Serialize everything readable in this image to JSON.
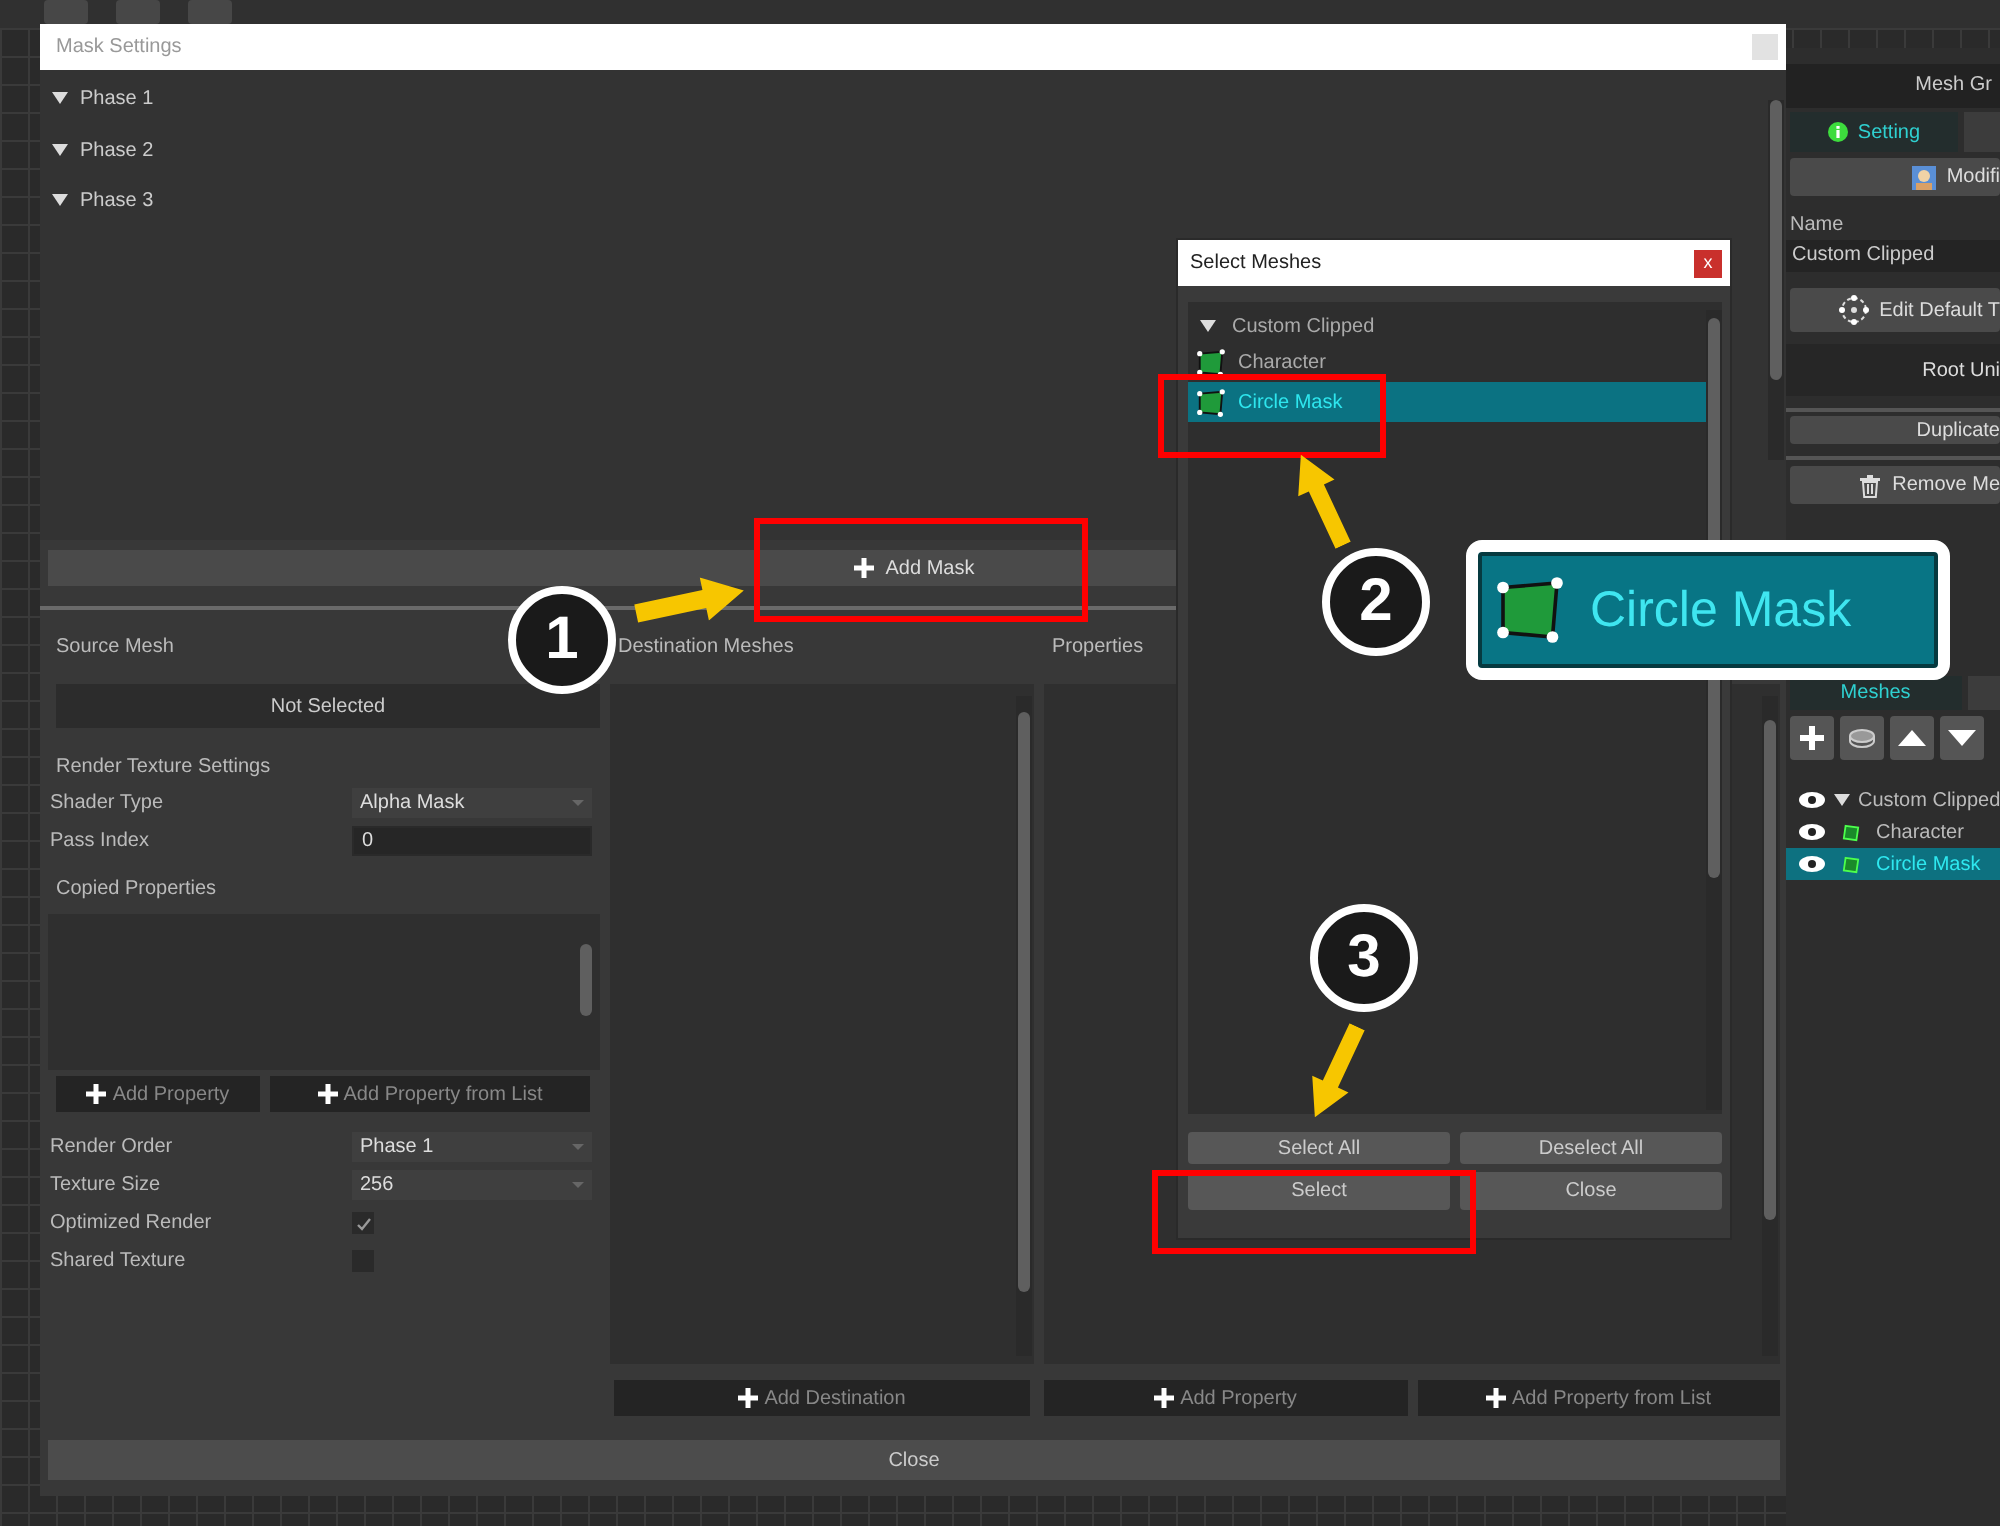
{
  "mask_window": {
    "title": "Mask Settings",
    "phases": [
      {
        "label": "Phase 1",
        "expanded": true
      },
      {
        "label": "Phase 2",
        "expanded": true
      },
      {
        "label": "Phase 3",
        "expanded": true
      }
    ],
    "add_mask": "Add Mask",
    "source_mesh": {
      "label": "Source Mesh",
      "value": "Not Selected"
    },
    "render_texture_settings": "Render Texture Settings",
    "shader_type": {
      "label": "Shader Type",
      "value": "Alpha Mask"
    },
    "pass_index": {
      "label": "Pass Index",
      "value": "0"
    },
    "copied_properties": {
      "label": "Copied Properties",
      "buttons": [
        "Add Property",
        "Add Property from List"
      ]
    },
    "render_order": {
      "label": "Render Order",
      "value": "Phase 1"
    },
    "texture_size": {
      "label": "Texture Size",
      "value": "256"
    },
    "options": [
      {
        "label": "Optimized Render",
        "checked": true
      },
      {
        "label": "Shared Texture",
        "checked": false
      }
    ],
    "destination_meshes": {
      "heading": "Destination Meshes",
      "button": "Add Destination"
    },
    "properties": {
      "heading": "Properties",
      "buttons": [
        "Add Property",
        "Add Property from List"
      ]
    },
    "close": "Close"
  },
  "select_meshes": {
    "title": "Select Meshes",
    "close": "x",
    "tree": {
      "label": "Custom Clipped",
      "expanded": true,
      "children": [
        {
          "label": "Character",
          "selected": false
        },
        {
          "label": "Circle Mask",
          "selected": true
        }
      ]
    },
    "buttons": [
      "Select All",
      "Deselect All",
      "Select",
      "Close"
    ]
  },
  "side_panel": {
    "header": "Mesh Gr",
    "tabs": [
      {
        "label": "Setting",
        "selected": true
      },
      {
        "selected": false
      }
    ],
    "modifier_button": "Modifi",
    "name_label": "Name",
    "name_value": "Custom Clipped",
    "edit_button": "Edit Default T",
    "root_unit": "Root Uni",
    "duplicate_button": "Duplicate",
    "remove_button": "Remove Me",
    "mesh_tabs": [
      {
        "label": "Meshes",
        "selected": true
      },
      {
        "selected": false
      }
    ],
    "tree": {
      "label": "Custom Clipped",
      "expanded": true,
      "children": [
        {
          "label": "Character",
          "selected": false
        },
        {
          "label": "Circle Mask",
          "selected": true
        }
      ]
    }
  },
  "annotations": {
    "steps": [
      "1",
      "2",
      "3"
    ],
    "callout": "Circle Mask"
  }
}
